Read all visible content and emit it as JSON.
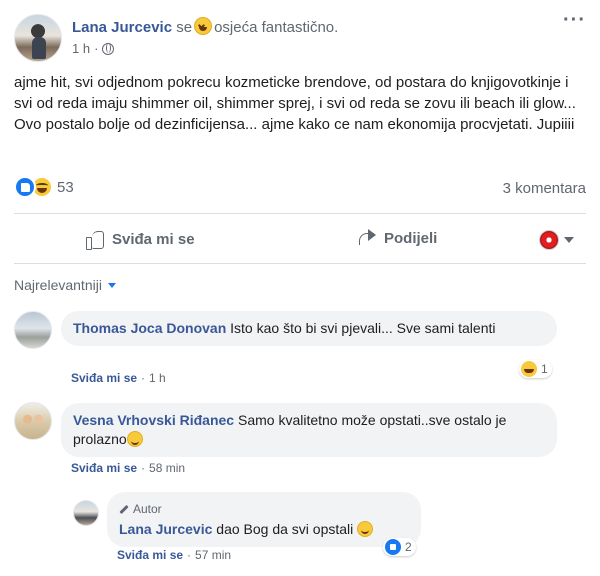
{
  "post": {
    "author": "Lana Jurcevic",
    "feeling_prefix": "se",
    "feeling_text": "osjeća fantastično.",
    "time": "1 h",
    "time_sep": "·",
    "more_label": "···",
    "text": "ajme hit, svi odjednom pokrecu kozmeticke brendove, od postara do knjigovotkinje i svi od reda imaju shimmer oil, shimmer sprej, i svi od reda se zovu ili beach ili glow... Ovo postalo bolje od dezinficijensa... ajme kako ce nam ekonomija procvjetati. Jupiiii",
    "reaction_count": "53",
    "comments_count": "3 komentara",
    "like_label": "Sviđa mi se",
    "share_label": "Podijeli"
  },
  "comments": {
    "sort_label": "Najrelevantniji",
    "items": [
      {
        "author": "Thomas Joca Donovan",
        "text": "Isto kao što bi svi pjevali... Sve sami talenti",
        "like": "Sviđa mi se",
        "sep": "·",
        "time": "1 h",
        "reaction_count": "1"
      },
      {
        "author": "Vesna Vrhovski Riđanec",
        "text": "Samo kvalitetno može opstati..sve ostalo je prolazno",
        "like": "Sviđa mi se",
        "sep": "·",
        "time": "58 min"
      },
      {
        "badge": "Autor",
        "author": "Lana Jurcevic",
        "text": "dao Bog da svi opstali",
        "like": "Sviđa mi se",
        "sep": "·",
        "time": "57 min",
        "reaction_count": "2"
      }
    ]
  }
}
